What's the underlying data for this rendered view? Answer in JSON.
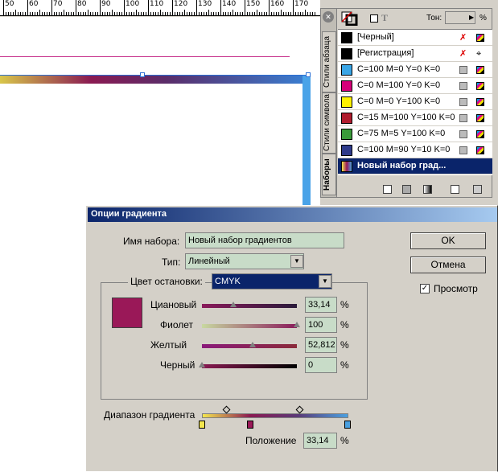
{
  "ruler": {
    "labels": [
      "50",
      "60",
      "70",
      "80",
      "90",
      "100",
      "110",
      "120",
      "130",
      "140",
      "150",
      "160",
      "170"
    ]
  },
  "panel": {
    "tabs": [
      "Наборы",
      "Стили символа",
      "Стили абзаца"
    ],
    "tone_label": "Тон:",
    "tone_value": "",
    "tone_unit": "%",
    "swatches": [
      {
        "name": "[Черный]",
        "color": "#000000"
      },
      {
        "name": "[Регистрация]",
        "color": "#000000"
      },
      {
        "name": "C=100 M=0 Y=0 K=0",
        "color": "#3aa6e6"
      },
      {
        "name": "C=0 M=100 Y=0 K=0",
        "color": "#d6007a"
      },
      {
        "name": "C=0 M=0 Y=100 K=0",
        "color": "#fff200"
      },
      {
        "name": "C=15 M=100 Y=100 K=0",
        "color": "#b01c2e"
      },
      {
        "name": "C=75 M=5 Y=100 K=0",
        "color": "#3a9a3a"
      },
      {
        "name": "C=100 M=90 Y=10 K=0",
        "color": "#2e3a8a"
      },
      {
        "name": "Новый набор град...",
        "color": "#a07a5a"
      }
    ]
  },
  "dialog": {
    "title": "Опции градиента",
    "name_label": "Имя набора:",
    "name_value": "Новый набор градиентов",
    "type_label": "Тип:",
    "type_value": "Линейный",
    "stop_color_label": "Цвет остановки:",
    "stop_color_value": "CMYK",
    "ok_label": "OK",
    "cancel_label": "Отмена",
    "preview_label": "Просмотр",
    "preview_checked": true,
    "preview_color": "#9a1858",
    "sliders": [
      {
        "label": "Циановый",
        "value": "33,14",
        "fraction": 0.33
      },
      {
        "label": "Фиолет",
        "value": "100",
        "fraction": 1.0
      },
      {
        "label": "Желтый",
        "value": "52,812",
        "fraction": 0.53
      },
      {
        "label": "Черный",
        "value": "0",
        "fraction": 0.0
      }
    ],
    "range_label": "Диапазон градиента",
    "position_label": "Положение",
    "position_value": "33,14",
    "percent": "%"
  }
}
